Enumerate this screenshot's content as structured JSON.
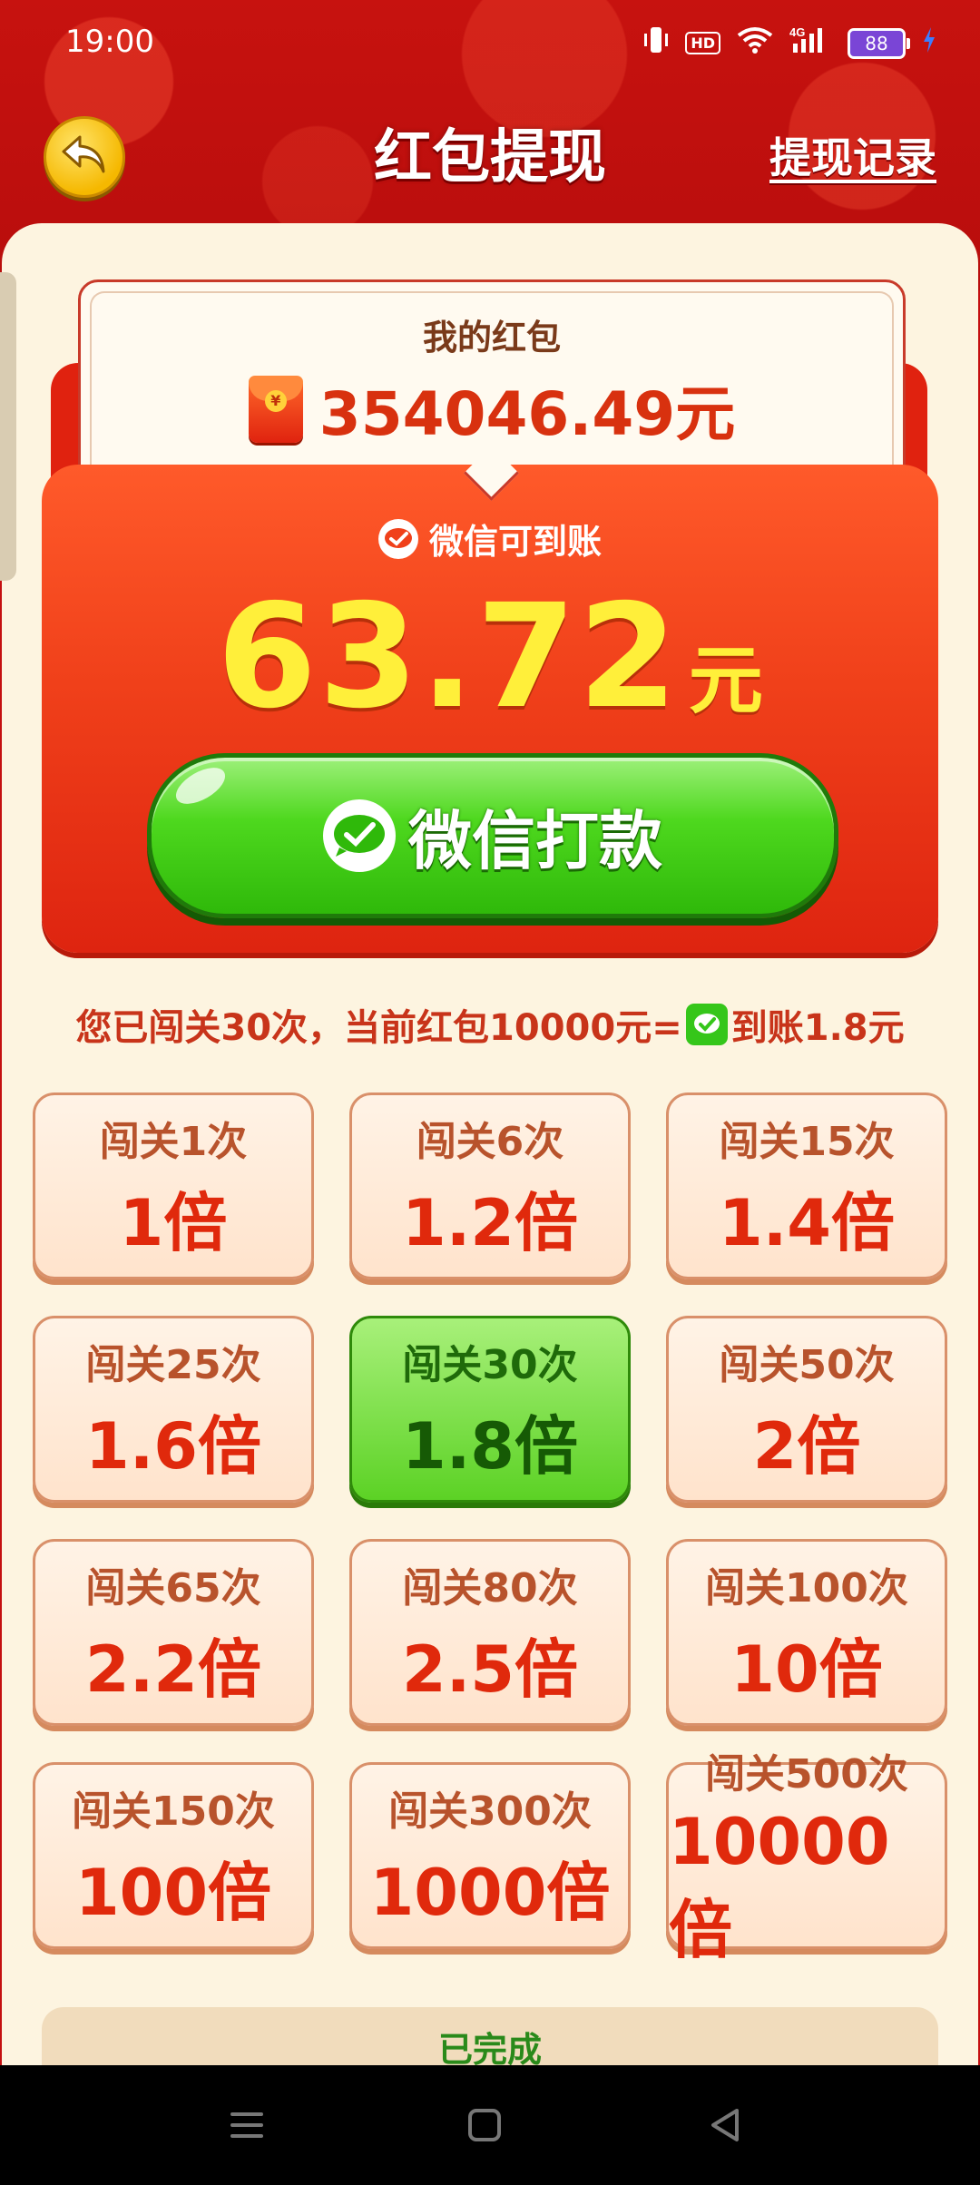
{
  "status_bar": {
    "time": "19:00",
    "network": "4G",
    "hd": "HD",
    "battery": "88"
  },
  "header": {
    "title": "红包提现",
    "record_link": "提现记录"
  },
  "balance": {
    "label": "我的红包",
    "amount": "354046.49元"
  },
  "withdraw": {
    "channel_label": "微信可到账",
    "amount": "63.72",
    "unit": "元",
    "button_label": "微信打款"
  },
  "info": {
    "text_before": "您已闯关30次，当前红包10000元=",
    "text_after": "到账1.8元"
  },
  "tiers": [
    {
      "label": "闯关1次",
      "multiplier": "1倍"
    },
    {
      "label": "闯关6次",
      "multiplier": "1.2倍"
    },
    {
      "label": "闯关15次",
      "multiplier": "1.4倍"
    },
    {
      "label": "闯关25次",
      "multiplier": "1.6倍"
    },
    {
      "label": "闯关30次",
      "multiplier": "1.8倍"
    },
    {
      "label": "闯关50次",
      "multiplier": "2倍"
    },
    {
      "label": "闯关65次",
      "multiplier": "2.2倍"
    },
    {
      "label": "闯关80次",
      "multiplier": "2.5倍"
    },
    {
      "label": "闯关100次",
      "multiplier": "10倍"
    },
    {
      "label": "闯关150次",
      "multiplier": "100倍"
    },
    {
      "label": "闯关300次",
      "multiplier": "1000倍"
    },
    {
      "label": "闯关500次",
      "multiplier": "10000倍"
    }
  ],
  "done": {
    "label": "已完成"
  },
  "colors": {
    "header_red": "#c40f10",
    "card_bg": "#fdf4e0",
    "amount_yellow": "#ffef3a",
    "active_green": "#5cd225"
  },
  "icons": [
    "back-arrow-icon",
    "vibrate-icon",
    "wifi-icon",
    "signal-icon",
    "battery-icon",
    "charging-icon",
    "red-packet-icon",
    "wechat-icon",
    "menu-icon",
    "home-icon",
    "back-triangle-icon"
  ]
}
